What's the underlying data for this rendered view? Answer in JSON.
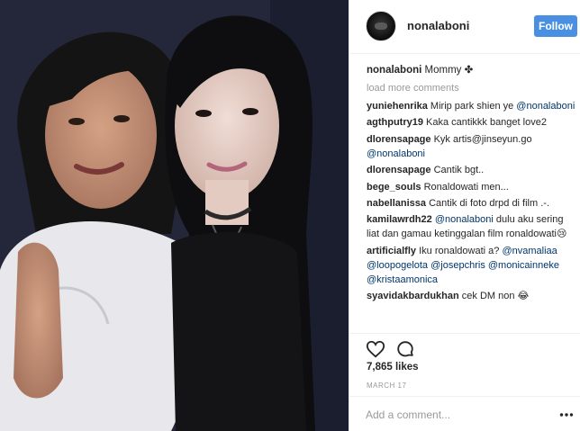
{
  "post": {
    "username": "nonalaboni",
    "follow_label": "Follow",
    "caption": {
      "author": "nonalaboni",
      "text": "Mommy ✤"
    },
    "load_more_label": "load more comments",
    "comments": [
      {
        "author": "yuniehenrika",
        "parts": [
          {
            "t": "text",
            "v": "Mirip park shien ye "
          },
          {
            "t": "mention",
            "v": "@nonalaboni"
          }
        ]
      },
      {
        "author": "agthputry19",
        "parts": [
          {
            "t": "text",
            "v": "Kaka cantikkk banget love2"
          }
        ]
      },
      {
        "author": "dlorensapage",
        "parts": [
          {
            "t": "text",
            "v": "Kyk artis@jinseyun.go "
          },
          {
            "t": "mention",
            "v": "@nonalaboni"
          }
        ]
      },
      {
        "author": "dlorensapage",
        "parts": [
          {
            "t": "text",
            "v": "Cantik bgt.."
          }
        ]
      },
      {
        "author": "bege_souls",
        "parts": [
          {
            "t": "text",
            "v": "Ronaldowati men..."
          }
        ]
      },
      {
        "author": "nabellanissa",
        "parts": [
          {
            "t": "text",
            "v": "Cantik di foto drpd di film .-."
          }
        ]
      },
      {
        "author": "kamilawrdh22",
        "parts": [
          {
            "t": "mention",
            "v": "@nonalaboni"
          },
          {
            "t": "text",
            "v": " dulu aku sering liat dan gamau ketinggalan film ronaldowati😢"
          }
        ]
      },
      {
        "author": "artificialfly",
        "parts": [
          {
            "t": "text",
            "v": "Iku ronaldowati a? "
          },
          {
            "t": "mention",
            "v": "@nvamaliaa"
          },
          {
            "t": "text",
            "v": " "
          },
          {
            "t": "mention",
            "v": "@loopogelota"
          },
          {
            "t": "text",
            "v": " "
          },
          {
            "t": "mention",
            "v": "@josepchris"
          },
          {
            "t": "text",
            "v": " "
          },
          {
            "t": "mention",
            "v": "@monicainneke"
          },
          {
            "t": "text",
            "v": " "
          },
          {
            "t": "mention",
            "v": "@kristaamonica"
          }
        ]
      },
      {
        "author": "syavidakbardukhan",
        "parts": [
          {
            "t": "text",
            "v": "cek DM non 😂"
          }
        ]
      }
    ],
    "likes": "7,865 likes",
    "date": "MARCH 17",
    "add_comment_placeholder": "Add a comment...",
    "icons": {
      "like": "heart-icon",
      "comment": "comment-icon",
      "more": "more-options-icon"
    },
    "colors": {
      "follow_button": "#4a90e2",
      "mention": "#003569",
      "muted": "#999999"
    }
  }
}
